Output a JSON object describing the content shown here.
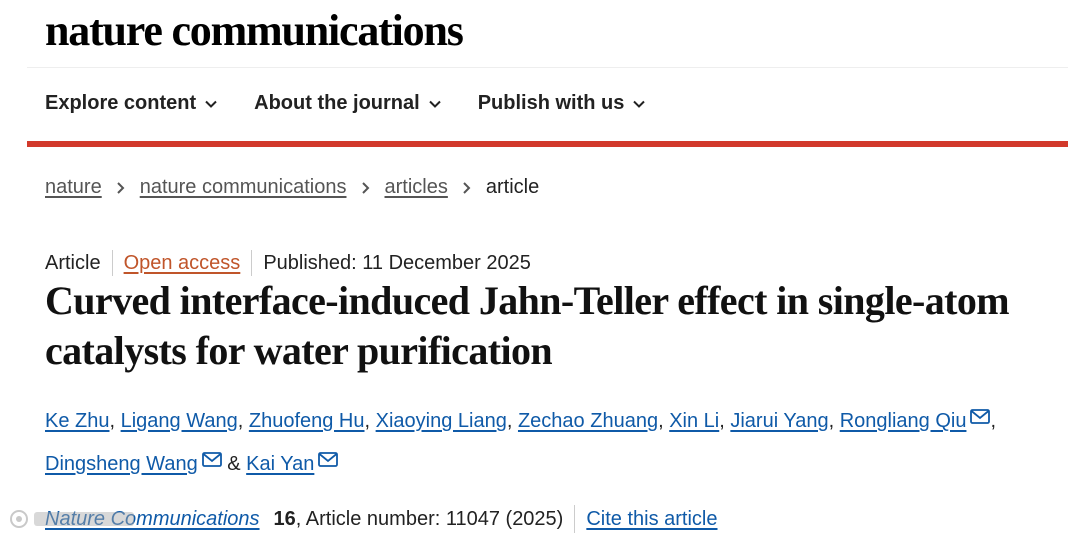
{
  "header": {
    "logo": "nature communications"
  },
  "nav": {
    "items": [
      {
        "label": "Explore content"
      },
      {
        "label": "About the journal"
      },
      {
        "label": "Publish with us"
      }
    ]
  },
  "breadcrumb": {
    "items": [
      "nature",
      "nature communications",
      "articles"
    ],
    "current": "article"
  },
  "article": {
    "type": "Article",
    "access": "Open access",
    "published": "Published: 11 December 2025",
    "title": "Curved interface-induced Jahn-Teller effect in single-atom catalysts for water purification",
    "authors": [
      "Ke Zhu",
      "Ligang Wang",
      "Zhuofeng Hu",
      "Xiaoying Liang",
      "Zechao Zhuang",
      "Xin Li",
      "Jiarui Yang",
      "Rongliang Qiu",
      "Dingsheng Wang",
      "Kai Yan"
    ],
    "author_sep": ",",
    "author_amp": "&"
  },
  "citation": {
    "journal": "Nature Communications",
    "volume": "16",
    "rest": ", Article number: 11047 (2025)",
    "cite_link": "Cite this article"
  },
  "colors": {
    "accent_red": "#d2392b",
    "link_blue": "#0f5aa8",
    "open_access": "#c0552a"
  }
}
